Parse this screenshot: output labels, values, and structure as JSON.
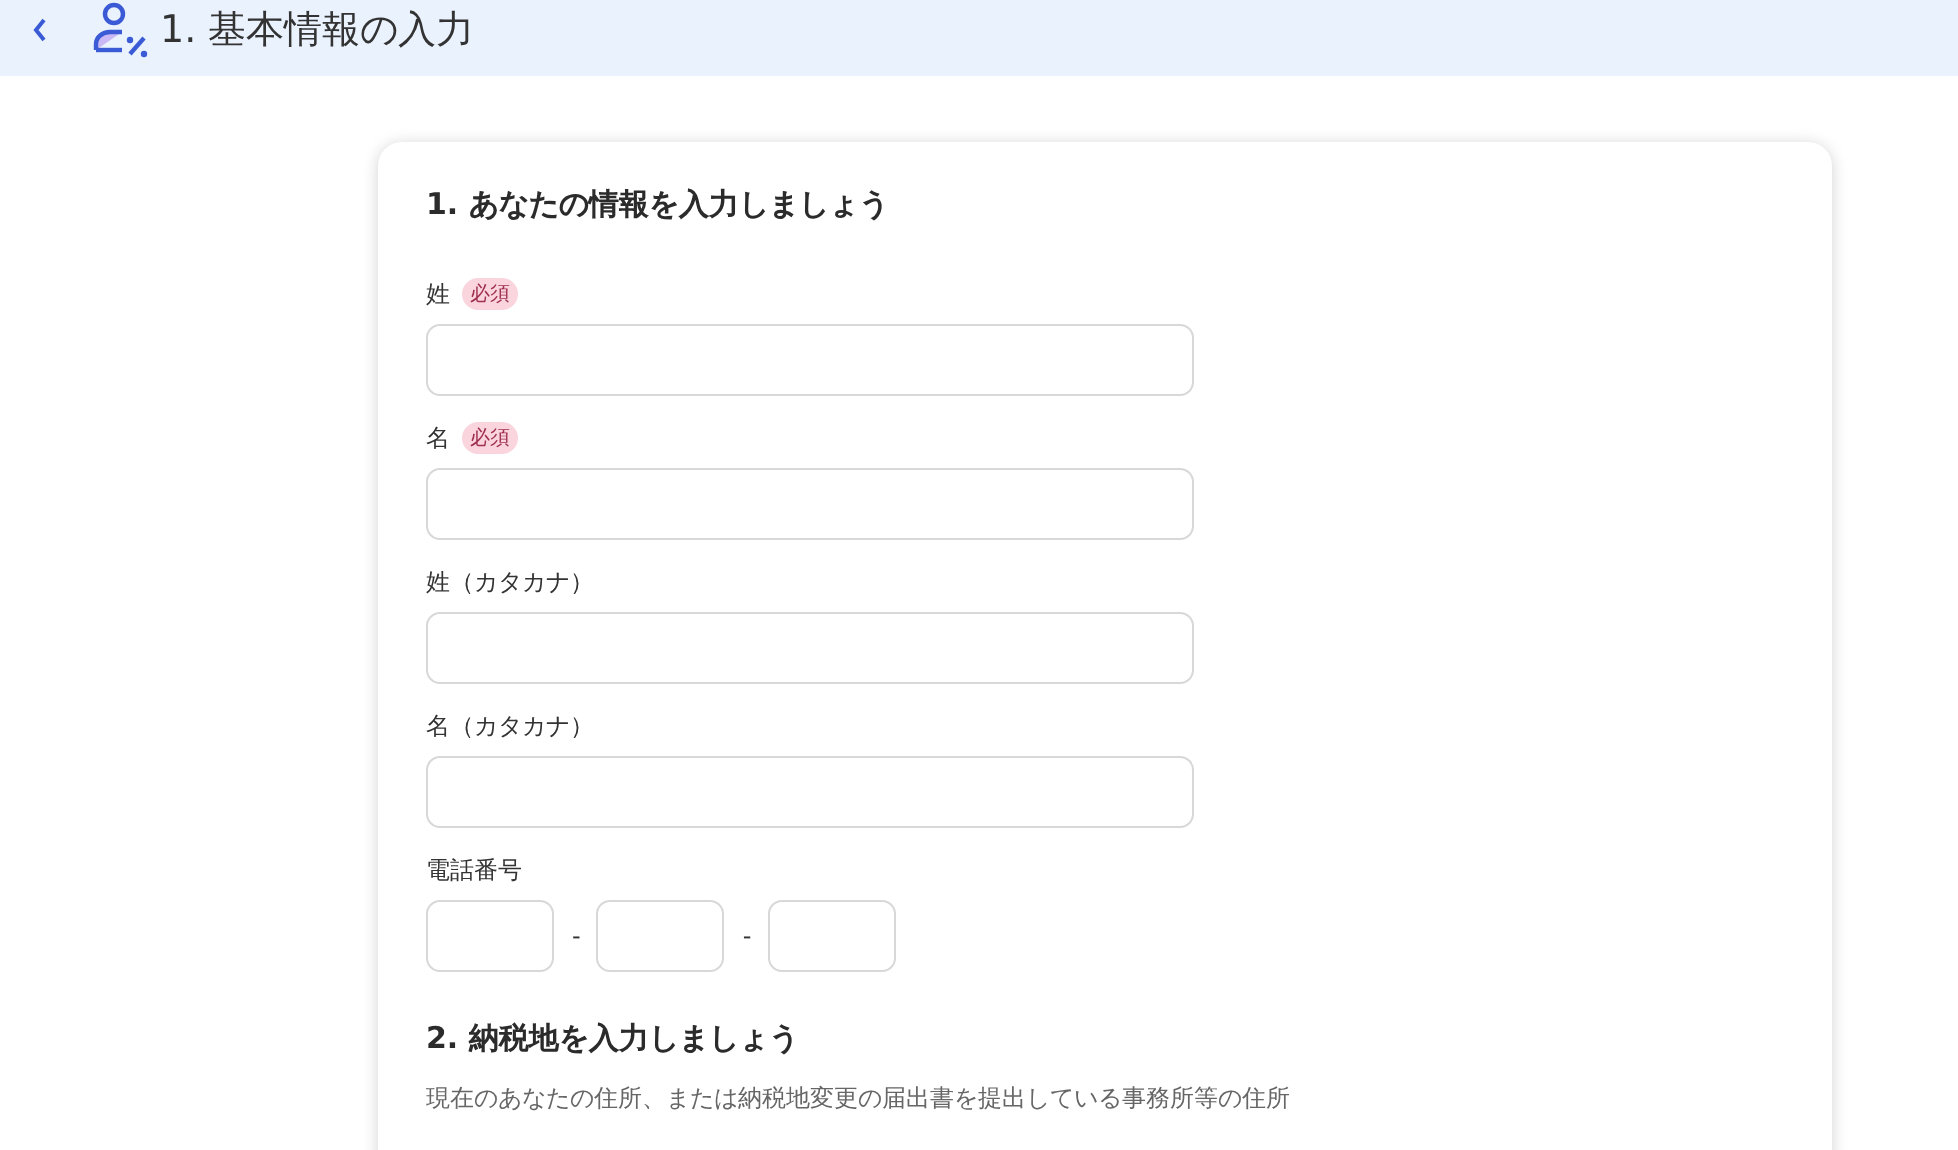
{
  "header": {
    "title": "1. 基本情報の入力"
  },
  "sections": [
    {
      "title": "1. あなたの情報を入力しましょう",
      "fields": [
        {
          "kind": "text",
          "label": "姓",
          "badge": "必須"
        },
        {
          "kind": "text",
          "label": "名",
          "badge": "必須"
        },
        {
          "kind": "text",
          "label": "姓（カタカナ）"
        },
        {
          "kind": "text",
          "label": "名（カタカナ）"
        },
        {
          "kind": "phone",
          "label": "電話番号",
          "separators": [
            "-",
            "-"
          ]
        }
      ]
    },
    {
      "title": "2. 納税地を入力しましょう",
      "description": "現在のあなたの住所、または納税地変更の届出書を提出している事務所等の住所"
    }
  ]
}
